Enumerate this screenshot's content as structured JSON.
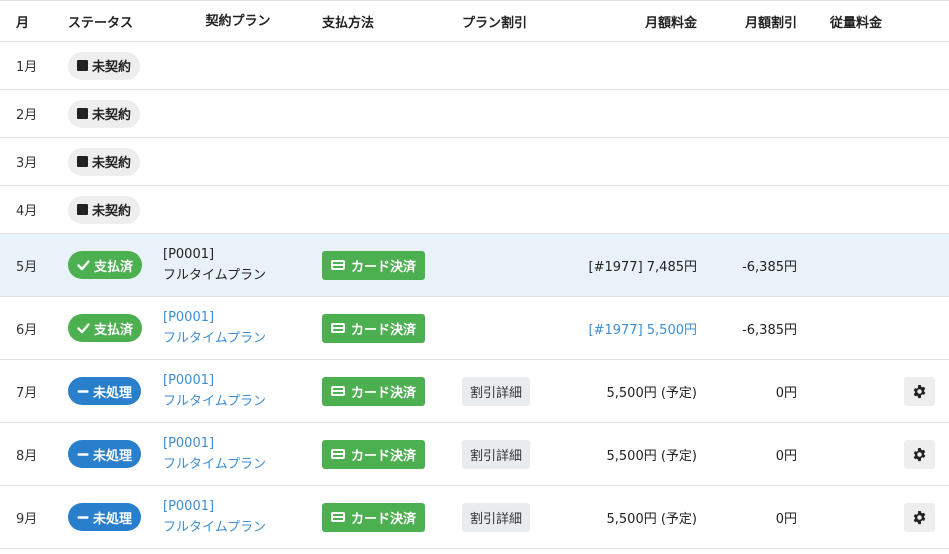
{
  "header": {
    "month": "月",
    "status": "ステータス",
    "plan": "契約プラン",
    "payment": "支払方法",
    "discount": "プラン割引",
    "monthly_fee": "月額料金",
    "monthly_discount": "月額割引",
    "usage_fee": "従量料金"
  },
  "rows": [
    {
      "month": "1月",
      "status": "未契約"
    },
    {
      "month": "2月",
      "status": "未契約"
    },
    {
      "month": "3月",
      "status": "未契約"
    },
    {
      "month": "4月",
      "status": "未契約"
    },
    {
      "month": "5月",
      "status": "支払済",
      "plan_code": "[P0001]",
      "plan_name": "フルタイムプラン",
      "payment": "カード決済",
      "monthly_fee": "[#1977] 7,485円",
      "monthly_discount": "-6,385円"
    },
    {
      "month": "6月",
      "status": "支払済",
      "plan_code": "[P0001]",
      "plan_name": "フルタイムプラン",
      "payment": "カード決済",
      "monthly_fee": "[#1977] 5,500円",
      "monthly_discount": "-6,385円"
    },
    {
      "month": "7月",
      "status": "未処理",
      "plan_code": "[P0001]",
      "plan_name": "フルタイムプラン",
      "payment": "カード決済",
      "discount": "割引詳細",
      "monthly_fee": "5,500円 (予定)",
      "monthly_discount": "0円"
    },
    {
      "month": "8月",
      "status": "未処理",
      "plan_code": "[P0001]",
      "plan_name": "フルタイムプラン",
      "payment": "カード決済",
      "discount": "割引詳細",
      "monthly_fee": "5,500円 (予定)",
      "monthly_discount": "0円"
    },
    {
      "month": "9月",
      "status": "未処理",
      "plan_code": "[P0001]",
      "plan_name": "フルタイムプラン",
      "payment": "カード決済",
      "discount": "割引詳細",
      "monthly_fee": "5,500円 (予定)",
      "monthly_discount": "0円"
    }
  ],
  "icons": {
    "unsigned": "square-icon",
    "paid": "check-icon",
    "pending": "minus-icon",
    "payment": "credit-card-icon",
    "settings": "gear-icon"
  },
  "colors": {
    "paid": "#4caf50",
    "pending": "#2a7fcc",
    "link": "#3d8ed4",
    "highlight_row": "#e9f1f9"
  }
}
